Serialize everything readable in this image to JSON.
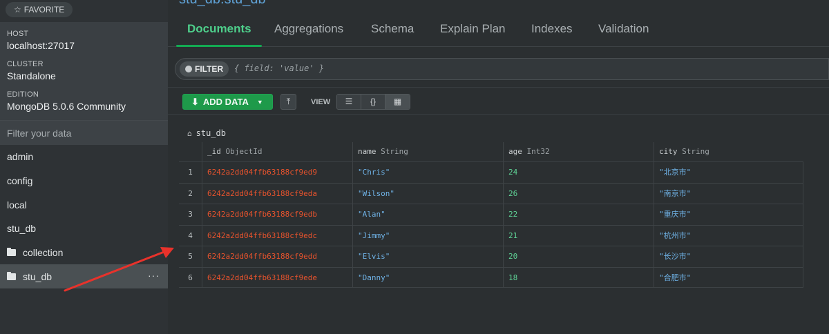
{
  "sidebar": {
    "favorite_label": "FAVORITE",
    "host_label": "HOST",
    "host_value": "localhost:27017",
    "cluster_label": "CLUSTER",
    "cluster_value": "Standalone",
    "edition_label": "EDITION",
    "edition_value": "MongoDB 5.0.6 Community",
    "filter_placeholder": "Filter your data",
    "databases": [
      "admin",
      "config",
      "local",
      "stu_db"
    ],
    "collections": [
      "collection",
      "stu_db"
    ],
    "more_label": "···"
  },
  "main": {
    "title": "stu_db.stu_db",
    "tabs": [
      "Documents",
      "Aggregations",
      "Schema",
      "Explain Plan",
      "Indexes",
      "Validation"
    ],
    "active_tab": "Documents",
    "filter": {
      "button_label": "FILTER",
      "query": "{ field: 'value' }"
    },
    "toolbar": {
      "add_data_label": "ADD DATA",
      "view_label": "VIEW"
    },
    "breadcrumb": "stu_db"
  },
  "table": {
    "columns": [
      {
        "name": "_id",
        "type": "ObjectId"
      },
      {
        "name": "name",
        "type": "String"
      },
      {
        "name": "age",
        "type": "Int32"
      },
      {
        "name": "city",
        "type": "String"
      }
    ],
    "rows": [
      {
        "num": "1",
        "id": "6242a2dd04ffb63188cf9ed9",
        "name": "\"Chris\"",
        "age": "24",
        "city": "\"北京市\""
      },
      {
        "num": "2",
        "id": "6242a2dd04ffb63188cf9eda",
        "name": "\"Wilson\"",
        "age": "26",
        "city": "\"南京市\""
      },
      {
        "num": "3",
        "id": "6242a2dd04ffb63188cf9edb",
        "name": "\"Alan\"",
        "age": "22",
        "city": "\"重庆市\""
      },
      {
        "num": "4",
        "id": "6242a2dd04ffb63188cf9edc",
        "name": "\"Jimmy\"",
        "age": "21",
        "city": "\"杭州市\""
      },
      {
        "num": "5",
        "id": "6242a2dd04ffb63188cf9edd",
        "name": "\"Elvis\"",
        "age": "20",
        "city": "\"长沙市\""
      },
      {
        "num": "6",
        "id": "6242a2dd04ffb63188cf9ede",
        "name": "\"Danny\"",
        "age": "18",
        "city": "\"合肥市\""
      }
    ]
  },
  "colors": {
    "accent_green": "#13aa52",
    "object_id": "#e8532d",
    "string": "#6fb2e6",
    "number": "#5fd396",
    "annotation_arrow": "#e8322b"
  }
}
